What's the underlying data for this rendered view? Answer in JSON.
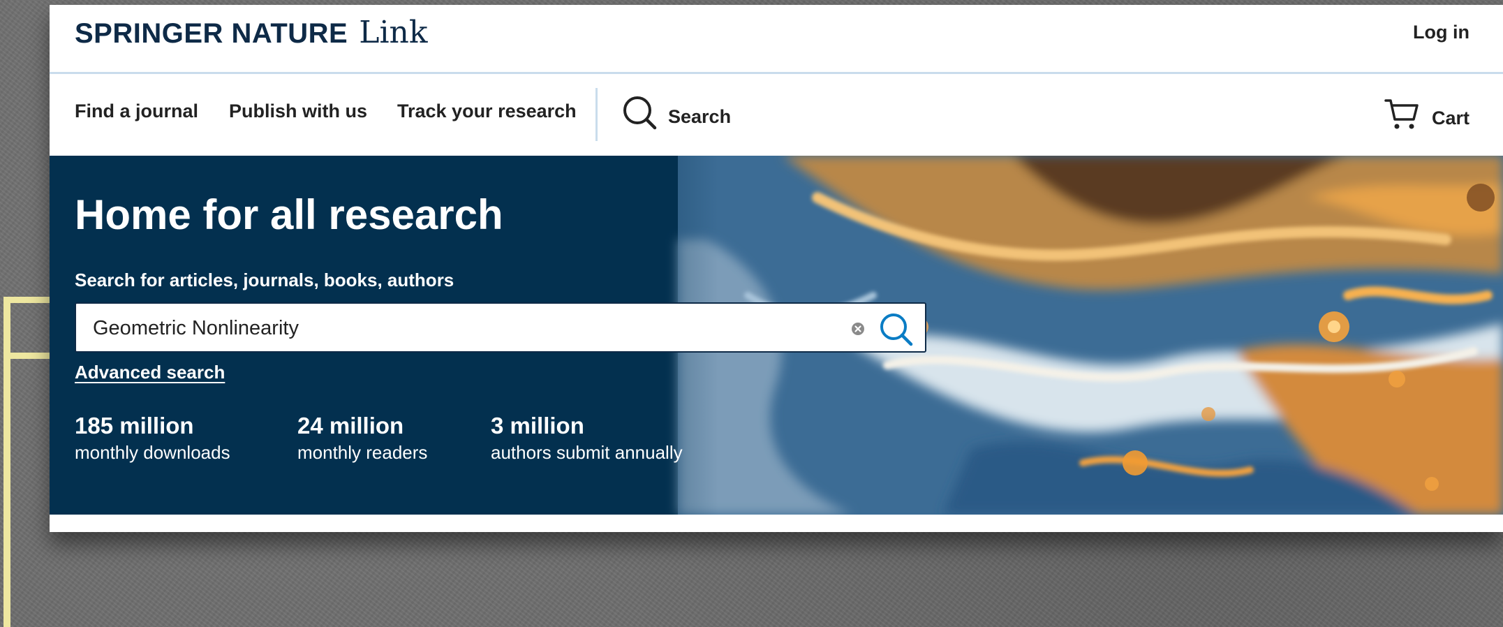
{
  "header": {
    "brand": "SPRINGER NATURE",
    "product": "Link",
    "login_label": "Log in"
  },
  "nav": {
    "items": [
      {
        "label": "Find a journal"
      },
      {
        "label": "Publish with us"
      },
      {
        "label": "Track your research"
      }
    ],
    "search_label": "Search",
    "cart_label": "Cart"
  },
  "hero": {
    "title": "Home for all research",
    "search_label": "Search for articles, journals, books, authors",
    "search_value": "Geometric Nonlinearity",
    "advanced_search_label": "Advanced search",
    "stats": [
      {
        "value": "185 million",
        "label": "monthly downloads"
      },
      {
        "value": "24 million",
        "label": "monthly readers"
      },
      {
        "value": "3 million",
        "label": "authors submit annually"
      }
    ]
  },
  "colors": {
    "brand_navy": "#0e2a47",
    "hero_background": "#03304f",
    "search_accent": "#0a7cc4",
    "divider": "#c9dcec",
    "highlight_bracket": "#eee7a0"
  },
  "icons": [
    "search-icon",
    "cart-icon",
    "clear-icon",
    "search-submit-icon"
  ]
}
